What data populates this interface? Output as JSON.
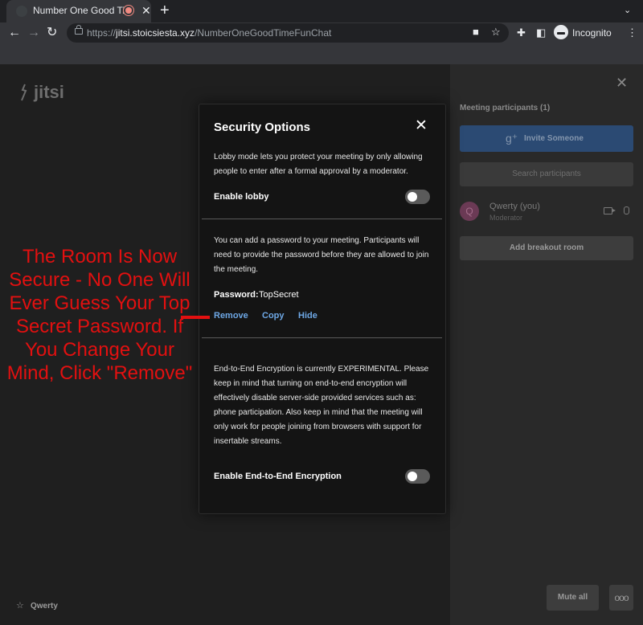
{
  "browser": {
    "tab_title": "Number One Good Time",
    "tab_close": "✕",
    "new_tab": "+",
    "tab_menu": "⌄",
    "nav_back": "←",
    "nav_forward": "→",
    "nav_reload": "↻",
    "url_prefix": "https://",
    "url_host": "jitsi.stoicsiesta.xyz",
    "url_path": "/NumberOneGoodTimeFunChat",
    "profile_label": "Incognito",
    "menu_dots": "⋮"
  },
  "jitsi": {
    "logo_text": "jitsi",
    "local_user": "Qwerty"
  },
  "participants": {
    "title": "Meeting participants (1)",
    "invite_label": "Invite Someone",
    "search_placeholder": "Search participants",
    "list": [
      {
        "initial": "Q",
        "name": "Qwerty (you)",
        "role": "Moderator"
      }
    ],
    "breakout_label": "Add breakout room",
    "mute_all_label": "Mute all",
    "more_label": "ooo"
  },
  "dialog": {
    "title": "Security Options",
    "close": "✕",
    "lobby_text": "Lobby mode lets you protect your meeting by only allowing people to enter after a formal approval by a moderator.",
    "lobby_label": "Enable lobby",
    "lobby_enabled": false,
    "password_text": "You can add a password to your meeting. Participants will need to provide the password before they are allowed to join the meeting.",
    "password_label": "Password:",
    "password_value": "TopSecret",
    "remove_label": "Remove",
    "copy_label": "Copy",
    "hide_label": "Hide",
    "e2ee_text": "End-to-End Encryption is currently EXPERIMENTAL. Please keep in mind that turning on end-to-end encryption will effectively disable server-side provided services such as: phone participation. Also keep in mind that the meeting will only work for people joining from browsers with support for insertable streams.",
    "e2ee_label": "Enable End-to-End Encryption",
    "e2ee_enabled": false
  },
  "annotation": {
    "text": "The Room Is Now Secure - No One Will Ever Guess Your Top Secret Password. If You Change Your Mind, Click \"Remove\"",
    "color": "#e31010"
  }
}
